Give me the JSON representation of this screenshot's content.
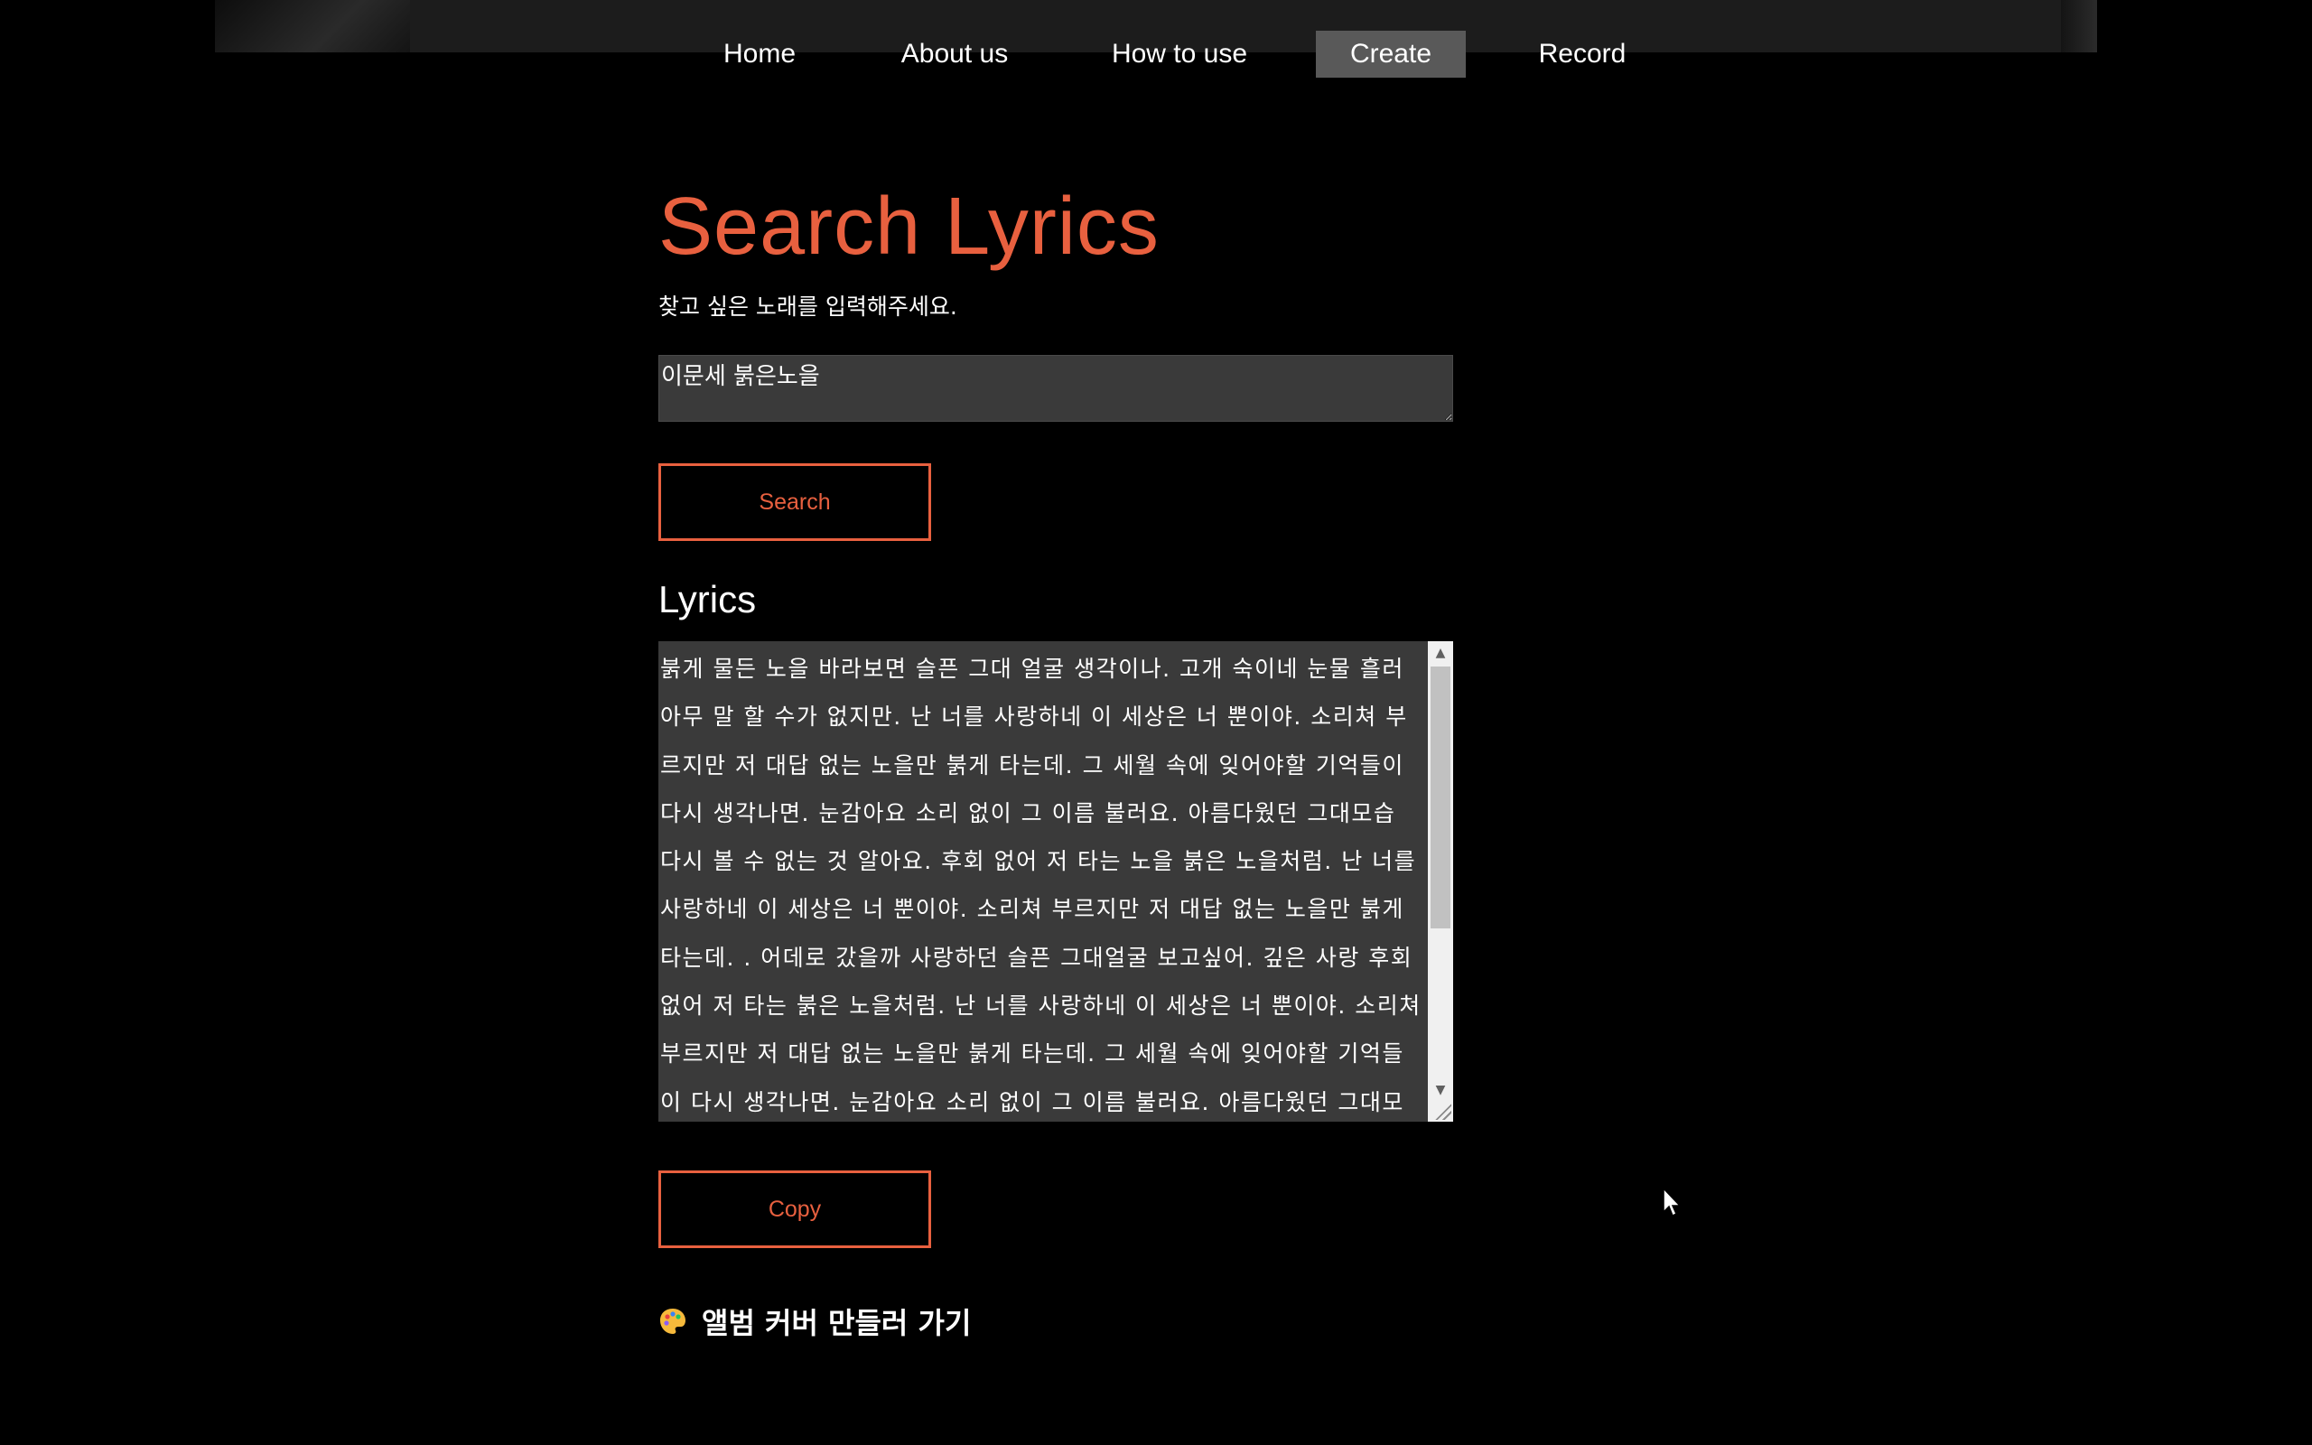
{
  "nav": {
    "items": [
      {
        "label": "Home"
      },
      {
        "label": "About us"
      },
      {
        "label": "How to use"
      },
      {
        "label": "Create",
        "active": true
      },
      {
        "label": "Record"
      }
    ]
  },
  "main": {
    "title": "Search Lyrics",
    "subtitle": "찾고 싶은 노래를 입력해주세요.",
    "search_input_value": "이문세 붉은노을",
    "search_button_label": "Search",
    "lyrics_heading": "Lyrics",
    "lyrics_text": "붉게 물든 노을 바라보면 슬픈 그대 얼굴 생각이나. 고개 숙이네 눈물 흘러 아무 말 할 수가 없지만. 난 너를 사랑하네 이 세상은 너 뿐이야. 소리쳐 부르지만 저 대답 없는 노을만 붉게 타는데. 그 세월 속에 잊어야할 기억들이 다시 생각나면. 눈감아요 소리 없이 그 이름 불러요. 아름다웠던 그대모습 다시 볼 수 없는 것 알아요. 후회 없어 저 타는 노을 붉은 노을처럼. 난 너를 사랑하네 이 세상은 너 뿐이야. 소리쳐 부르지만 저 대답 없는 노을만 붉게 타는데. . 어데로 갔을까 사랑하던 슬픈 그대얼굴 보고싶어. 깊은 사랑 후회 없어 저 타는 붉은 노을처럼. 난 너를 사랑하네 이 세상은 너 뿐이야. 소리쳐 부르지만 저 대답 없는 노을만 붉게 타는데. 그 세월 속에 잊어야할 기억들이 다시 생각나면. 눈감아요 소리 없이 그 이름 불러요. 아름다웠던 그대모습 다시 볼 수 없는 것",
    "copy_button_label": "Copy",
    "album_cover_link": "앨범 커버 만들러 가기",
    "album_cover_icon": "palette-icon"
  },
  "colors": {
    "accent": "#e8603f",
    "background": "#000000",
    "field_background": "#3a3a3a",
    "nav_active": "#595959"
  }
}
